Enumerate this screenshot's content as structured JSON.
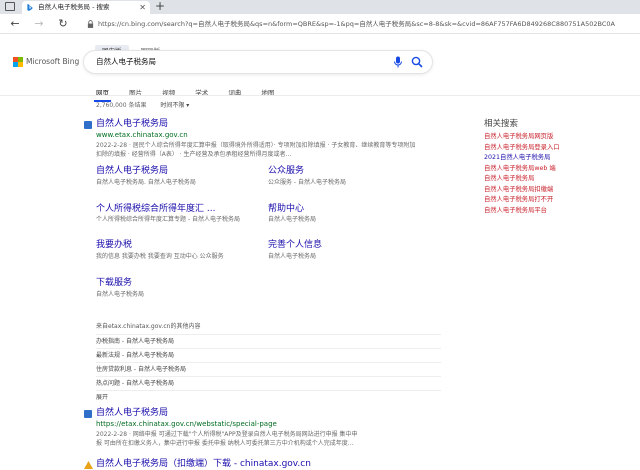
{
  "browser": {
    "tab_title": "自然人电子税务局 - 搜索",
    "close_glyph": "✕",
    "new_tab_glyph": "+",
    "url": "https://cn.bing.com/search?q=自然人电子税务局&qs=n&form=QBRE&sp=-1&pq=自然人电子税务局&sc=8-8&sk=&cvid=86AF757FA6D849268C880751A502BC0A"
  },
  "bing": {
    "region_tabs": [
      "国内版",
      "国际版"
    ],
    "logo_text": "Microsoft Bing",
    "query": "自然人电子税务局",
    "scopes": [
      "网页",
      "图片",
      "视频",
      "学术",
      "词典",
      "地图"
    ],
    "result_count": "2,760,000 条结果",
    "time_filter": "时间不限 ▾"
  },
  "results": {
    "first": {
      "title": "自然人电子税务局",
      "url": "www.etax.chinatax.gov.cn",
      "snippet_date": "2022-2-28 ·",
      "snippet": "居民个人综合所得年度汇算申报（取得境外所得适用）· 专项附加扣除填报 · 子女教育、继续教育等专项附加扣除的填报 · 经营所得（A表） · 生产经营及承包承租经营所得月度或者…",
      "deeplinks": [
        {
          "title": "自然人电子税务局",
          "desc": "自然人电子税务局. 自然人电子税务局"
        },
        {
          "title": "公众服务",
          "desc": "公众服务 - 自然人电子税务局"
        },
        {
          "title": "个人所得税综合所得年度汇 ...",
          "desc": "个人所得税综合所得年度汇算专题 - 自然人电子税务局"
        },
        {
          "title": "帮助中心",
          "desc": "自然人电子税务局"
        },
        {
          "title": "我要办税",
          "desc": "我的信息 我要办税 我要查询 互动中心 公众服务"
        },
        {
          "title": "完善个人信息",
          "desc": "自然人电子税务局"
        },
        {
          "title": "下载服务",
          "desc": "自然人电子税务局"
        }
      ],
      "more_head": "来自etax.chinatax.gov.cn的其他内容",
      "more_items": [
        "办税指南 - 自然人电子税务局",
        "最新法规 - 自然人电子税务局",
        "住房贷款利息 - 自然人电子税务局",
        "热点问题 - 自然人电子税务局",
        "展开"
      ]
    },
    "second": {
      "title": "自然人电子税务局",
      "url": "https://etax.chinatax.gov.cn/webstatic/special-page",
      "snippet_date": "2022-2-28 ·",
      "snippet_line1": "网络申报 可通过下载\"个人所得税\"APP及登录自然人电子税务局网站进行申报 集中申",
      "snippet_line2": "报 可由所在扣缴义务人，集中进行申报 委托申报 纳税人可委托第三方中介机构或个人完成年度…"
    },
    "third": {
      "title": "自然人电子税务局（扣缴端）下载 - chinatax.gov.cn"
    }
  },
  "related": {
    "heading": "相关搜索",
    "items": [
      {
        "normal": "自然人电子税务局",
        "bold": "网页版"
      },
      {
        "normal": "自然人电子税务局",
        "bold": "登录入口"
      },
      {
        "normal": "2021自然人电子税务局",
        "bold": ""
      },
      {
        "normal": "自然人电子税务局",
        "bold": "web 端"
      },
      {
        "normal": "自然人电子税务局",
        "bold": ""
      },
      {
        "normal": "自然人电子税务局",
        "bold": "扣缴端"
      },
      {
        "normal": "自然人电子税务局",
        "bold": "打不开"
      },
      {
        "normal": "自然人电子税务局",
        "bold": "平台"
      }
    ]
  },
  "colors": {
    "link": "#1a0dab",
    "url_green": "#006d21",
    "related_red": "#c7202b",
    "bing_blue": "#174ae4"
  }
}
